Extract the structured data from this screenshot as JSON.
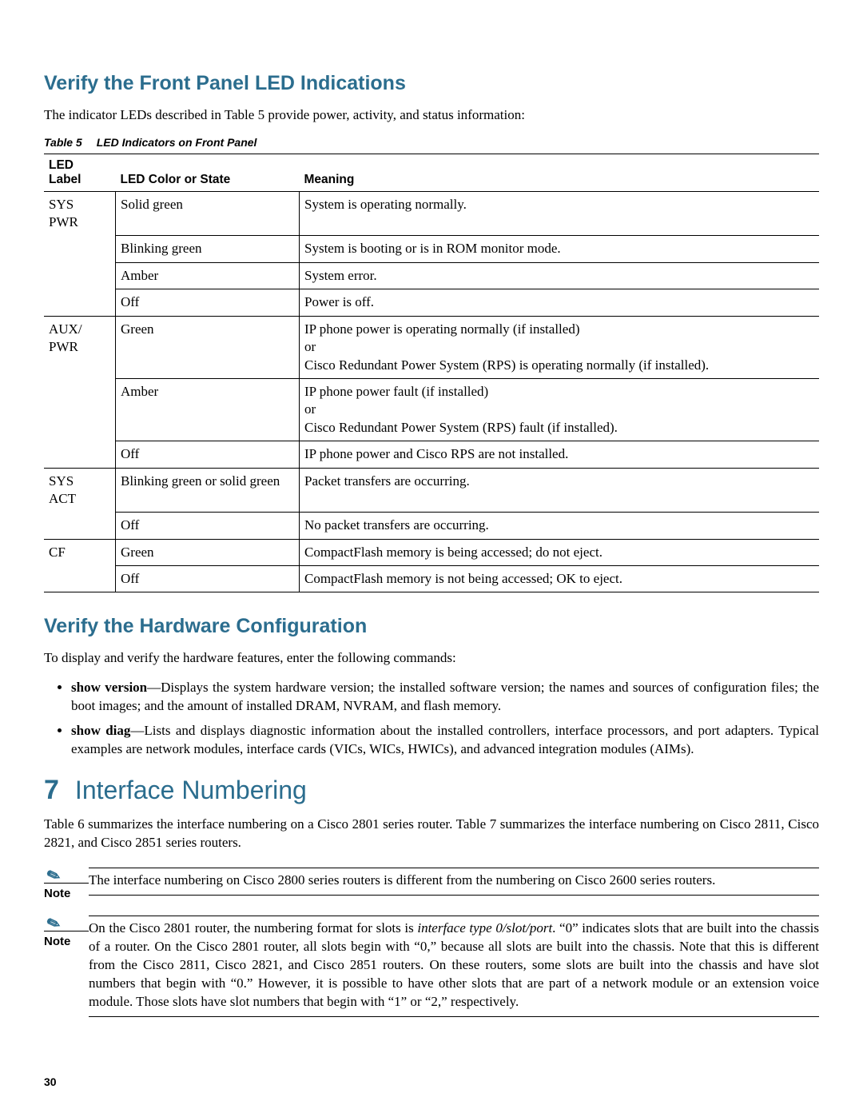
{
  "headings": {
    "h2a": "Verify the Front Panel LED Indications",
    "h2b": "Verify the Hardware Configuration",
    "sec7_num": "7",
    "sec7_title": "Interface Numbering"
  },
  "paras": {
    "intro_led": "The indicator LEDs described in Table 5 provide power, activity, and status information:",
    "hwcfg_intro": "To display and verify the hardware features, enter the following commands:",
    "ifnum_intro": "Table 6 summarizes the interface numbering on a Cisco 2801 series router. Table 7 summarizes the interface numbering on Cisco 2811, Cisco 2821, and Cisco 2851 series routers."
  },
  "table5": {
    "caption_label": "Table 5",
    "caption_title": "LED Indicators on Front Panel",
    "headers": {
      "c1": "LED Label",
      "c2": "LED Color or State",
      "c3": "Meaning"
    },
    "rows": [
      {
        "group_start": true,
        "label": "SYS PWR",
        "state": "Solid green",
        "meaning": "System is operating normally."
      },
      {
        "group_start": false,
        "label": "",
        "state": "Blinking green",
        "meaning": "System is booting or is in ROM monitor mode."
      },
      {
        "group_start": false,
        "label": "",
        "state": "Amber",
        "meaning": "System error."
      },
      {
        "group_start": false,
        "label": "",
        "state": "Off",
        "meaning": "Power is off."
      },
      {
        "group_start": true,
        "label": "AUX/ PWR",
        "state": "Green",
        "meaning": "IP phone power is operating normally (if installed)\nor\nCisco Redundant Power System (RPS) is operating normally (if installed)."
      },
      {
        "group_start": false,
        "label": "",
        "state": "Amber",
        "meaning": "IP phone power fault (if installed)\nor\nCisco Redundant Power System (RPS) fault (if installed)."
      },
      {
        "group_start": false,
        "label": "",
        "state": "Off",
        "meaning": "IP phone power and Cisco RPS are not installed."
      },
      {
        "group_start": true,
        "label": "SYS ACT",
        "state": "Blinking green or solid green",
        "meaning": "Packet transfers are occurring."
      },
      {
        "group_start": false,
        "label": "",
        "state": "Off",
        "meaning": "No packet transfers are occurring."
      },
      {
        "group_start": true,
        "label": "CF",
        "state": "Green",
        "meaning": "CompactFlash memory is being accessed; do not eject."
      },
      {
        "group_start": false,
        "label": "",
        "state": "Off",
        "meaning": "CompactFlash memory is not being accessed; OK to eject."
      }
    ]
  },
  "commands": [
    {
      "name": "show version",
      "desc": "—Displays the system hardware version; the installed software version; the names and sources of configuration files; the boot images; and the amount of installed DRAM, NVRAM, and flash memory."
    },
    {
      "name": "show diag",
      "desc": "—Lists and displays diagnostic information about the installed controllers, interface processors, and port adapters. Typical examples are network modules, interface cards (VICs, WICs, HWICs), and advanced integration modules (AIMs)."
    }
  ],
  "notes": {
    "label": "Note",
    "n1": "The interface numbering on Cisco 2800 series routers is different from the numbering on Cisco 2600 series routers.",
    "n2_pre": "On the Cisco 2801 router, the numbering format for slots is ",
    "n2_em": "interface type 0/slot/port",
    "n2_post": ". “0” indicates slots that are built into the chassis of a router. On the Cisco 2801 router, all slots begin with “0,” because all slots are built into the chassis. Note that this is different from the Cisco 2811, Cisco 2821, and Cisco 2851 routers. On these routers, some slots are built into the chassis and have slot numbers that begin with “0.” However, it is possible to have other slots that are part of a network module or an extension voice module. Those slots have slot numbers that begin with “1” or “2,” respectively."
  },
  "page_number": "30"
}
